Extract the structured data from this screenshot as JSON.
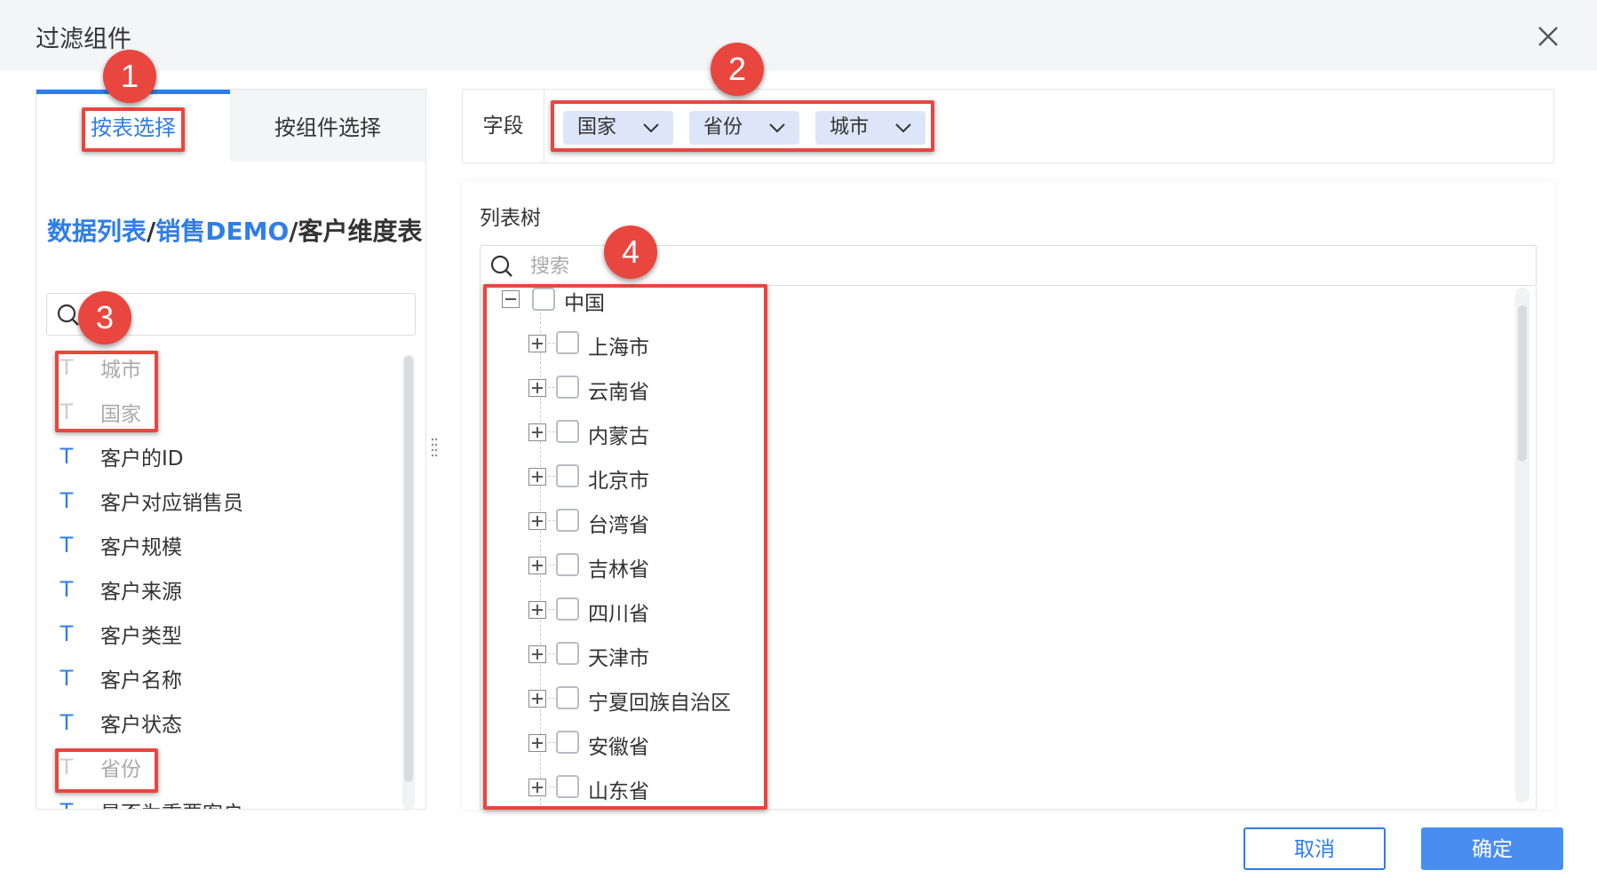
{
  "dialog": {
    "title": "过滤组件",
    "close_icon": "close-icon"
  },
  "left": {
    "tabs": [
      {
        "label": "按表选择",
        "active": true
      },
      {
        "label": "按组件选择",
        "active": false
      }
    ],
    "breadcrumb": {
      "part1": "数据列表",
      "sep1": "/",
      "part2": "销售DEMO",
      "sep2": "/",
      "current": "客户维度表"
    },
    "search_placeholder": "搜索",
    "fields": [
      {
        "label": "城市",
        "type_icon": "T",
        "disabled": true
      },
      {
        "label": "国家",
        "type_icon": "T",
        "disabled": true
      },
      {
        "label": "客户的ID",
        "type_icon": "T",
        "disabled": false
      },
      {
        "label": "客户对应销售员",
        "type_icon": "T",
        "disabled": false
      },
      {
        "label": "客户规模",
        "type_icon": "T",
        "disabled": false
      },
      {
        "label": "客户来源",
        "type_icon": "T",
        "disabled": false
      },
      {
        "label": "客户类型",
        "type_icon": "T",
        "disabled": false
      },
      {
        "label": "客户名称",
        "type_icon": "T",
        "disabled": false
      },
      {
        "label": "客户状态",
        "type_icon": "T",
        "disabled": false
      },
      {
        "label": "省份",
        "type_icon": "T",
        "disabled": true
      },
      {
        "label": "是否为重要客户",
        "type_icon": "T",
        "disabled": false
      }
    ]
  },
  "right": {
    "field_label": "字段",
    "chips": [
      "国家",
      "省份",
      "城市"
    ],
    "tree_title": "列表树",
    "tree_search_placeholder": "搜索",
    "tree": {
      "root": "中国",
      "children": [
        "上海市",
        "云南省",
        "内蒙古",
        "北京市",
        "台湾省",
        "吉林省",
        "四川省",
        "天津市",
        "宁夏回族自治区",
        "安徽省",
        "山东省"
      ]
    }
  },
  "footer": {
    "cancel_label": "取消",
    "ok_label": "确定"
  },
  "annotations": {
    "badges": [
      "1",
      "2",
      "3",
      "4"
    ],
    "color": "#e8463e"
  },
  "colors": {
    "accent": "#2f7ee6",
    "chip_bg": "#dce6f8",
    "header_bg": "#f4f5f7",
    "primary_button": "#4a8df0"
  }
}
